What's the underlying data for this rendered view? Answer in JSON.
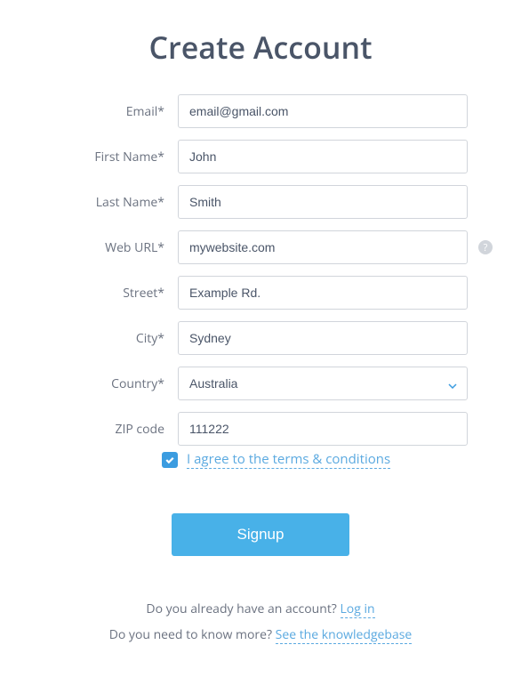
{
  "title": "Create Account",
  "fields": {
    "email": {
      "label": "Email*",
      "value": "email@gmail.com"
    },
    "firstName": {
      "label": "First Name*",
      "value": "John"
    },
    "lastName": {
      "label": "Last Name*",
      "value": "Smith"
    },
    "webUrl": {
      "label": "Web URL*",
      "value": "mywebsite.com"
    },
    "street": {
      "label": "Street*",
      "value": "Example Rd."
    },
    "city": {
      "label": "City*",
      "value": "Sydney"
    },
    "country": {
      "label": "Country*",
      "value": "Australia"
    },
    "zip": {
      "label": "ZIP code",
      "value": "111222"
    }
  },
  "terms": {
    "checked": true,
    "label": "I agree to the terms & conditions"
  },
  "signupButton": "Signup",
  "footer": {
    "loginPrompt": "Do you already have an account? ",
    "loginLink": "Log in",
    "kbPrompt": "Do you need to know more? ",
    "kbLink": "See the knowledgebase"
  },
  "helpTooltip": "?"
}
